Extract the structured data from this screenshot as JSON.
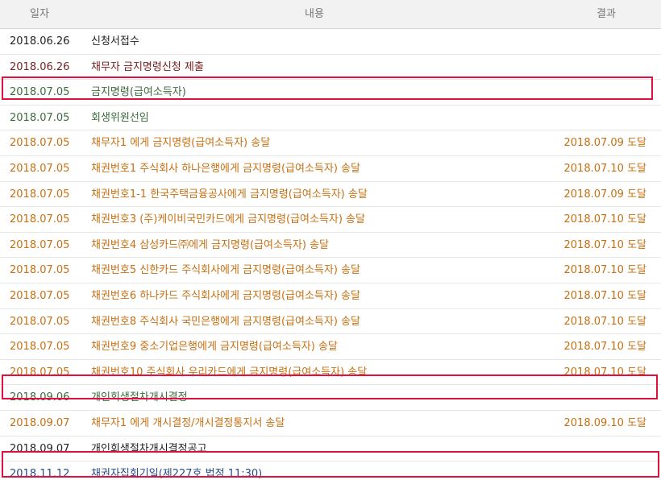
{
  "table": {
    "headers": {
      "date": "일자",
      "content": "내용",
      "result": "결과"
    },
    "rows": [
      {
        "date": "2018.06.26",
        "content": "신청서접수",
        "result": "",
        "color": "black"
      },
      {
        "date": "2018.06.26",
        "content": "채무자      금지명령신청 제출",
        "result": "",
        "color": "darkred"
      },
      {
        "date": "2018.07.05",
        "content": "금지명령(급여소득자)",
        "result": "",
        "color": "green"
      },
      {
        "date": "2018.07.05",
        "content": "회생위원선임",
        "result": "",
        "color": "green"
      },
      {
        "date": "2018.07.05",
        "content": "채무자1          에게 금지명령(급여소득자) 송달",
        "result": "2018.07.09 도달",
        "color": "orange"
      },
      {
        "date": "2018.07.05",
        "content": "채권번호1 주식회사 하나은행에게 금지명령(급여소득자) 송달",
        "result": "2018.07.10 도달",
        "color": "orange"
      },
      {
        "date": "2018.07.05",
        "content": "채권번호1-1 한국주택금융공사에게 금지명령(급여소득자) 송달",
        "result": "2018.07.09 도달",
        "color": "orange"
      },
      {
        "date": "2018.07.05",
        "content": "채권번호3 (주)케이비국민카드에게 금지명령(급여소득자) 송달",
        "result": "2018.07.10 도달",
        "color": "orange"
      },
      {
        "date": "2018.07.05",
        "content": "채권번호4 삼성카드㈜에게 금지명령(급여소득자) 송달",
        "result": "2018.07.10 도달",
        "color": "orange"
      },
      {
        "date": "2018.07.05",
        "content": "채권번호5 신한카드 주식회사에게 금지명령(급여소득자) 송달",
        "result": "2018.07.10 도달",
        "color": "orange"
      },
      {
        "date": "2018.07.05",
        "content": "채권번호6 하나카드 주식회사에게 금지명령(급여소득자) 송달",
        "result": "2018.07.10 도달",
        "color": "orange"
      },
      {
        "date": "2018.07.05",
        "content": "채권번호8 주식회사 국민은행에게 금지명령(급여소득자) 송달",
        "result": "2018.07.10 도달",
        "color": "orange"
      },
      {
        "date": "2018.07.05",
        "content": "채권번호9 중소기업은행에게 금지명령(급여소득자) 송달",
        "result": "2018.07.10 도달",
        "color": "orange"
      },
      {
        "date": "2018.07.05",
        "content": "채권번호10 주식회사 우리카드에게 금지명령(급여소득자) 송달",
        "result": "2018.07.10 도달",
        "color": "orange"
      },
      {
        "date": "2018.09.06",
        "content": "개인회생절차개시결정",
        "result": "",
        "color": "green"
      },
      {
        "date": "2018.09.07",
        "content": "채무자1          에게 개시결정/개시결정통지서 송달",
        "result": "2018.09.10 도달",
        "color": "orange"
      },
      {
        "date": "2018.09.07",
        "content": "개인회생절차개시결정공고",
        "result": "",
        "color": "black"
      },
      {
        "date": "2018.11.12",
        "content": "채권자집회기일(제227호 법정 11:30)",
        "result": "",
        "color": "blue"
      }
    ]
  },
  "colors": {
    "black": "#222222",
    "darkred": "#7a1f1f",
    "green": "#3c6b3c",
    "orange": "#c76f12",
    "blue": "#234a8a",
    "highlight": "#e0103f",
    "header_bg": "#f2f2f2"
  }
}
